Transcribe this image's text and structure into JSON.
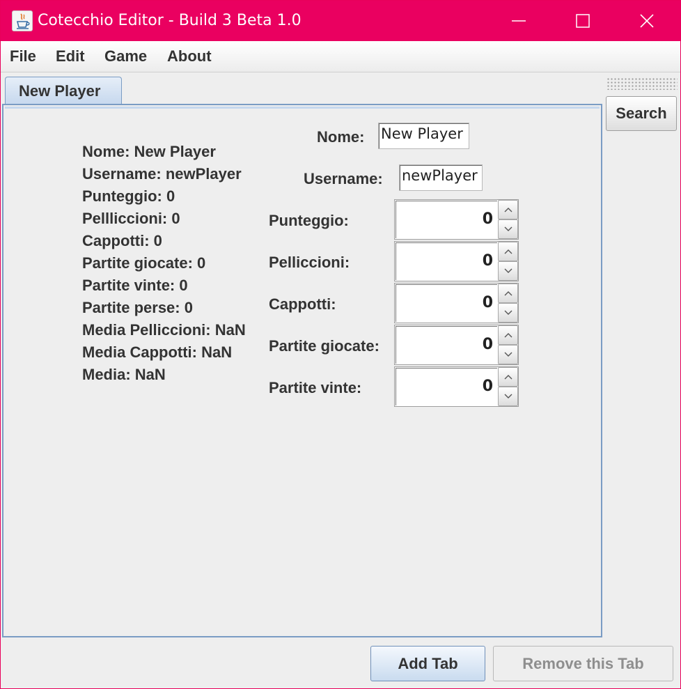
{
  "window": {
    "title": "Cotecchio Editor - Build 3 Beta 1.0",
    "accent_color": "#ea0060"
  },
  "menu": [
    "File",
    "Edit",
    "Game",
    "About"
  ],
  "tabs": [
    {
      "label": "New Player",
      "selected": true
    }
  ],
  "search_button": "Search",
  "player_info": [
    "Nome: New Player",
    "Username: newPlayer",
    "Punteggio: 0",
    "Pellliccioni: 0",
    "Cappotti: 0",
    "Partite giocate: 0",
    "Partite vinte: 0",
    "Partite perse: 0",
    "Media Pelliccioni: NaN",
    "Media Cappotti: NaN",
    "Media: NaN"
  ],
  "form": {
    "nome_label": "Nome:",
    "nome_value": "New Player",
    "username_label": "Username:",
    "username_value": "newPlayer",
    "spinners": [
      {
        "label": "Punteggio:",
        "value": "0"
      },
      {
        "label": "Pelliccioni:",
        "value": "0"
      },
      {
        "label": "Cappotti:",
        "value": "0"
      },
      {
        "label": "Partite giocate:",
        "value": "0"
      },
      {
        "label": "Partite vinte:",
        "value": "0"
      }
    ]
  },
  "buttons": {
    "add_tab": "Add Tab",
    "remove_tab": "Remove this Tab",
    "remove_tab_enabled": false
  },
  "icons": {
    "app": "java-cup-icon",
    "minimize": "minimize-icon",
    "maximize": "maximize-icon",
    "close": "close-icon",
    "spinner_up": "chevron-up-icon",
    "spinner_down": "chevron-down-icon"
  }
}
